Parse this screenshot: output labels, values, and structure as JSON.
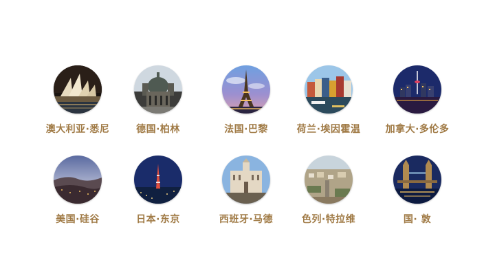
{
  "cities": [
    {
      "label": "澳大利亚·悉尼",
      "photo": "sydney-opera-house-night"
    },
    {
      "label": "德国·柏林",
      "photo": "berlin-cathedral"
    },
    {
      "label": "法国·巴黎",
      "photo": "eiffel-tower-dusk"
    },
    {
      "label": "荷兰·埃因霍温",
      "photo": "dutch-canal-houses"
    },
    {
      "label": "加拿大·多伦多",
      "photo": "toronto-skyline-night"
    },
    {
      "label": "美国·硅谷",
      "photo": "silicon-valley-sunset"
    },
    {
      "label": "日本·东京",
      "photo": "tokyo-tower-night"
    },
    {
      "label": "西班牙·马德",
      "photo": "madrid-palace"
    },
    {
      "label": "色列·特拉维",
      "photo": "tel-aviv-aerial"
    },
    {
      "label": "国·   敦",
      "photo": "tower-bridge-night"
    }
  ],
  "colors": {
    "label": "#a07a45",
    "background": "#ffffff"
  }
}
